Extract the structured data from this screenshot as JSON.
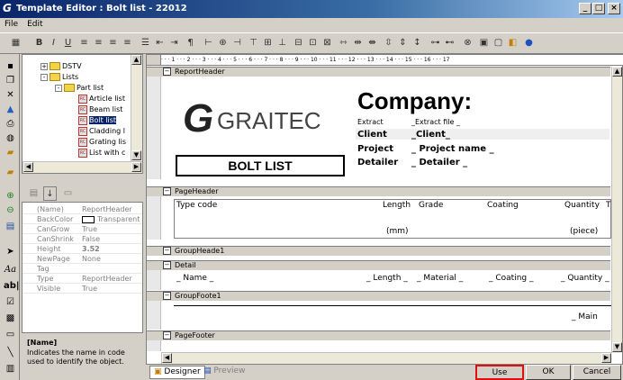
{
  "window": {
    "title": "Template Editor : Bolt list - 22012",
    "minimize": "_",
    "maximize": "□",
    "close": "×"
  },
  "menu": [
    "File",
    "Edit"
  ],
  "tree": {
    "items": [
      {
        "label": "DSTV",
        "type": "folder",
        "toggle": "+"
      },
      {
        "label": "Lists",
        "type": "folder",
        "toggle": "-"
      },
      {
        "label": "Part list",
        "type": "folder",
        "toggle": "-"
      },
      {
        "label": "Article list",
        "type": "report"
      },
      {
        "label": "Beam list",
        "type": "report"
      },
      {
        "label": "Bolt list",
        "type": "report",
        "selected": true
      },
      {
        "label": "Cladding l",
        "type": "report"
      },
      {
        "label": "Grating lis",
        "type": "report"
      },
      {
        "label": "List with c",
        "type": "report"
      }
    ]
  },
  "properties": {
    "rows": [
      {
        "key": "(Name)",
        "value": "ReportHeader"
      },
      {
        "key": "BackColor",
        "value": "Transparent"
      },
      {
        "key": "CanGrow",
        "value": "True"
      },
      {
        "key": "CanShrink",
        "value": "False"
      },
      {
        "key": "Height",
        "value": "3.52"
      },
      {
        "key": "NewPage",
        "value": "None"
      },
      {
        "key": "Tag",
        "value": ""
      },
      {
        "key": "Type",
        "value": "ReportHeader"
      },
      {
        "key": "Visible",
        "value": "True"
      }
    ]
  },
  "description": {
    "title": "[Name]",
    "text": "Indicates the name in code used to identify the object."
  },
  "ruler": "· · · 1 · · · 2 · · · 3 · · · 4 · · · 5 · · · 6 · · · 7 · · · 8 · · · 9 · · · 10 · · · 11 · · · 12 · · · 13 · · · 14 · · · 15 · · · 16 · · · 17",
  "report": {
    "bands": {
      "report_header": "ReportHeader",
      "page_header": "PageHeader",
      "group_header": "GroupHeade1",
      "detail": "Detail",
      "group_footer": "GroupFoote1",
      "page_footer": "PageFooter"
    },
    "logo_text": "GRAITEC",
    "logo_mark": "G",
    "company": "Company:",
    "extract_label": "Extract",
    "extract_value": "_Extract file _",
    "client_label": "Client",
    "client_value": "_Client_",
    "project_label": "Project",
    "project_value": "_ Project name _",
    "detailer_label": "Detailer",
    "detailer_value": "_ Detailer _",
    "list_title": "BOLT LIST",
    "cols": {
      "type_code": "Type code",
      "length": "Length",
      "grade": "Grade",
      "coating": "Coating",
      "quantity": "Quantity",
      "extra": "T"
    },
    "units": {
      "length": "(mm)",
      "quantity": "(piece)"
    },
    "detail": {
      "name": "_ Name _",
      "length": "_ Length _",
      "material": "_ Material _",
      "coating": "_ Coating _",
      "quantity": "_ Quantity _"
    },
    "footer_main": "_ Main"
  },
  "tabs": {
    "designer": "Designer",
    "preview": "Preview"
  },
  "buttons": {
    "use": "Use",
    "ok": "OK",
    "cancel": "Cancel"
  },
  "colors": {
    "highlight": "#e01010",
    "selection": "#0a246a"
  }
}
